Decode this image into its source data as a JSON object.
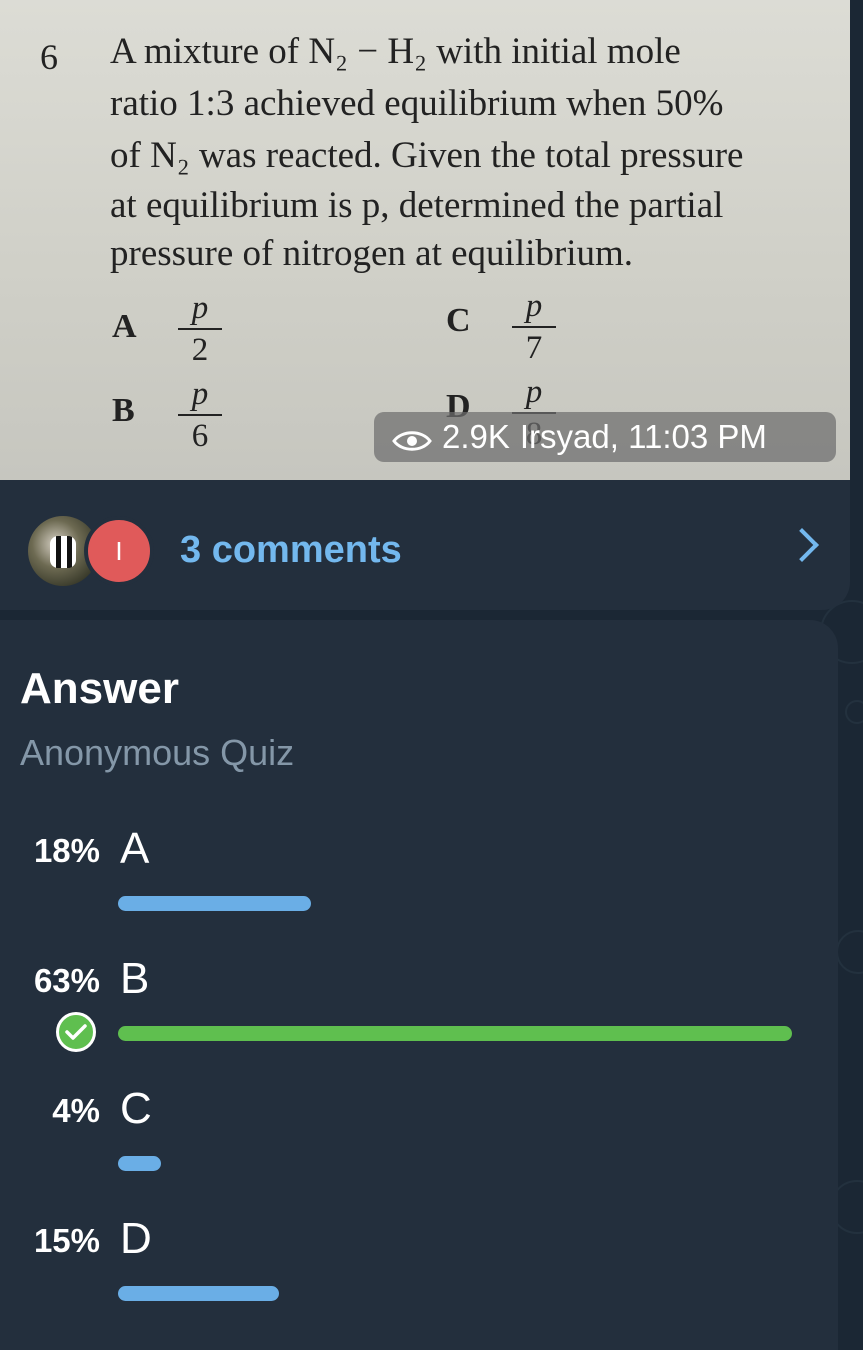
{
  "post": {
    "question": {
      "number": "6",
      "lines": [
        "A mixture of N₂ − H₂ with initial mole",
        "ratio 1:3 achieved equilibrium when 50%",
        "of N₂ was reacted. Given the total pressure",
        "at equilibrium is p, determined the partial",
        "pressure of nitrogen at equilibrium."
      ],
      "options": [
        {
          "letter": "A",
          "num": "p",
          "den": "2"
        },
        {
          "letter": "B",
          "num": "p",
          "den": "6"
        },
        {
          "letter": "C",
          "num": "p",
          "den": "7"
        },
        {
          "letter": "D",
          "num": "p",
          "den": "8"
        }
      ]
    },
    "views": "2.9K",
    "author_time": "Irsyad, 11:03 PM",
    "avatar2_letter": "I",
    "comments_label": "3 comments"
  },
  "poll": {
    "title": "Answer",
    "subtitle": "Anonymous Quiz",
    "options": [
      {
        "percent_label": "18%",
        "label": "A",
        "percent": 18,
        "correct": false
      },
      {
        "percent_label": "63%",
        "label": "B",
        "percent": 63,
        "correct": true
      },
      {
        "percent_label": "4%",
        "label": "C",
        "percent": 4,
        "correct": false
      },
      {
        "percent_label": "15%",
        "label": "D",
        "percent": 15,
        "correct": false
      }
    ]
  },
  "colors": {
    "background": "#1b2734",
    "bubble": "#232f3d",
    "link": "#73b8ee",
    "bar": "#6aaee6",
    "correct": "#5fbf4f"
  }
}
